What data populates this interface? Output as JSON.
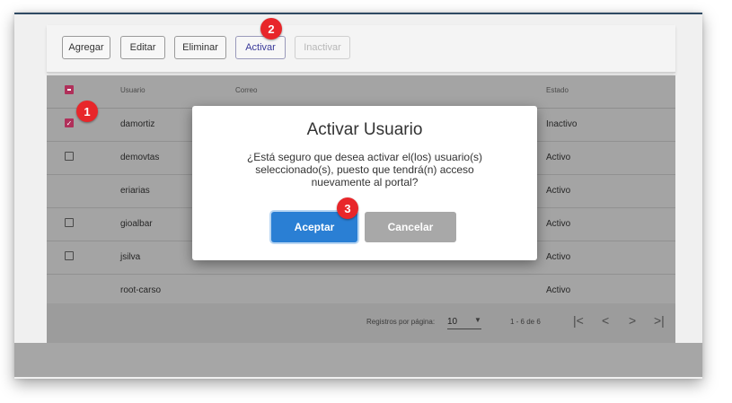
{
  "toolbar": {
    "agregar": "Agregar",
    "editar": "Editar",
    "eliminar": "Eliminar",
    "activar": "Activar",
    "inactivar": "Inactivar"
  },
  "table": {
    "headers": {
      "usuario": "Usuario",
      "correo": "Correo",
      "estado": "Estado"
    },
    "rows": [
      {
        "usuario": "damortiz",
        "estado": "Inactivo",
        "checkbox": "checked"
      },
      {
        "usuario": "demovtas",
        "estado": "Activo",
        "checkbox": "unchecked"
      },
      {
        "usuario": "eriarias",
        "estado": "Activo",
        "checkbox": "none"
      },
      {
        "usuario": "gioalbar",
        "estado": "Activo",
        "checkbox": "unchecked"
      },
      {
        "usuario": "jsilva",
        "estado": "Activo",
        "checkbox": "unchecked"
      },
      {
        "usuario": "root-carso",
        "estado": "Activo",
        "checkbox": "none"
      }
    ]
  },
  "pager": {
    "rows_label": "Registros por página:",
    "rows_value": "10",
    "range": "1 - 6 de 6",
    "first": "|<",
    "prev": "<",
    "next": ">",
    "last": ">|"
  },
  "modal": {
    "title": "Activar Usuario",
    "message": "¿Está seguro que desea activar el(los) usuario(s) seleccionado(s), puesto que tendrá(n) acceso nuevamente al portal?",
    "accept": "Aceptar",
    "cancel": "Cancelar"
  },
  "badges": {
    "one": "1",
    "two": "2",
    "three": "3"
  },
  "colors": {
    "accent": "#2a7fd4",
    "checkbox": "#b0305a",
    "badge": "#e8262a"
  }
}
